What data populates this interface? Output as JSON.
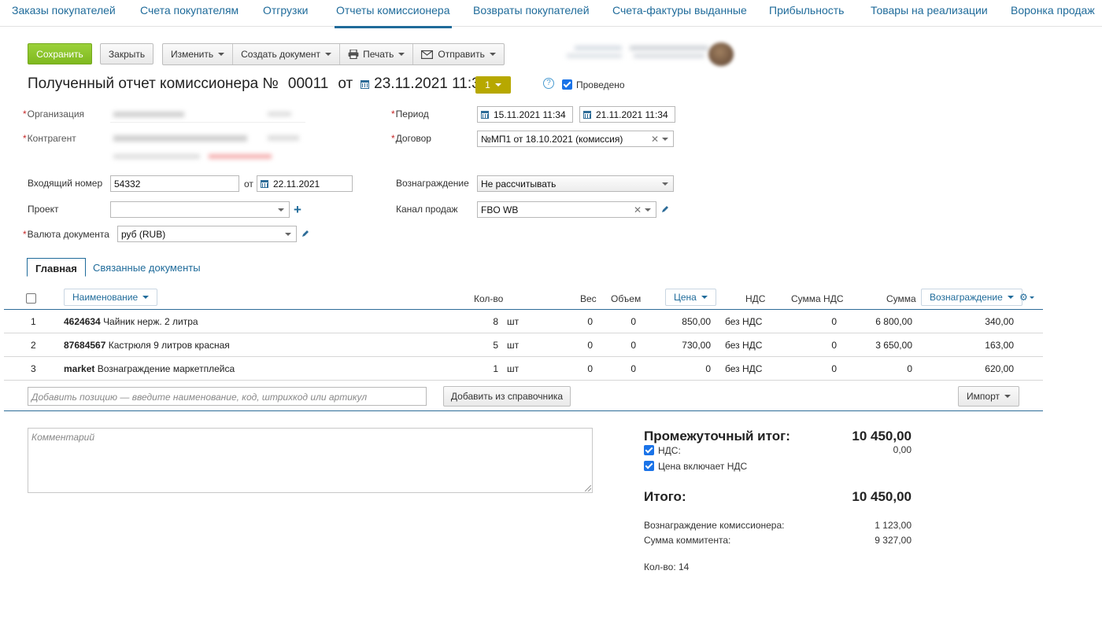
{
  "topnav": [
    {
      "label": "Заказы покупателей"
    },
    {
      "label": "Счета покупателям"
    },
    {
      "label": "Отгрузки"
    },
    {
      "label": "Отчеты комиссионера"
    },
    {
      "label": "Возвраты покупателей"
    },
    {
      "label": "Счета-фактуры выданные"
    },
    {
      "label": "Прибыльность"
    },
    {
      "label": "Товары на реализации"
    },
    {
      "label": "Воронка продаж"
    }
  ],
  "toolbar": {
    "save": "Сохранить",
    "close": "Закрыть",
    "edit": "Изменить",
    "create_doc": "Создать документ",
    "print": "Печать",
    "send": "Отправить"
  },
  "header": {
    "title": "Полученный отчет комиссионера №",
    "number": "00011",
    "ot": "от",
    "datetime": "23.11.2021 11:30",
    "status": "1",
    "posted_label": "Проведено"
  },
  "form": {
    "org_label": "Организация",
    "contractor_label": "Контрагент",
    "period_label": "Период",
    "period_from": "15.11.2021 11:34",
    "period_to": "21.11.2021 11:34",
    "contract_label": "Договор",
    "contract_value": "№МП1 от 18.10.2021 (комиссия)",
    "incoming_label": "Входящий номер",
    "incoming_value": "54332",
    "incoming_ot": "от",
    "incoming_date": "22.11.2021",
    "reward_label": "Вознаграждение",
    "reward_value": "Не рассчитывать",
    "project_label": "Проект",
    "project_value": "",
    "channel_label": "Канал продаж",
    "channel_value": "FBO WB",
    "currency_label": "Валюта документа",
    "currency_value": "руб (RUB)"
  },
  "tabs": {
    "main": "Главная",
    "related": "Связанные документы"
  },
  "table": {
    "headers": {
      "name": "Наименование",
      "qty": "Кол-во",
      "weight": "Вес",
      "volume": "Объем",
      "price": "Цена",
      "vat": "НДС",
      "vat_sum": "Сумма НДС",
      "sum": "Сумма",
      "reward": "Вознаграждение"
    },
    "rows": [
      {
        "n": "1",
        "code": "4624634",
        "name": "Чайник нерж. 2 литра",
        "qty": "8",
        "unit": "шт",
        "weight": "0",
        "volume": "0",
        "price": "850,00",
        "vat": "без НДС",
        "vat_sum": "0",
        "sum": "6 800,00",
        "reward": "340,00"
      },
      {
        "n": "2",
        "code": "87684567",
        "name": "Кастрюля 9 литров красная",
        "qty": "5",
        "unit": "шт",
        "weight": "0",
        "volume": "0",
        "price": "730,00",
        "vat": "без НДС",
        "vat_sum": "0",
        "sum": "3 650,00",
        "reward": "163,00"
      },
      {
        "n": "3",
        "code": "market",
        "name": "Вознаграждение маркетплейса",
        "qty": "1",
        "unit": "шт",
        "weight": "0",
        "volume": "0",
        "price": "0",
        "vat": "без НДС",
        "vat_sum": "0",
        "sum": "0",
        "reward": "620,00"
      }
    ],
    "add_placeholder": "Добавить позицию — введите наименование, код, штрихкод или артикул",
    "add_from_catalog": "Добавить из справочника",
    "import": "Импорт"
  },
  "comment_placeholder": "Комментарий",
  "totals": {
    "subtotal_label": "Промежуточный итог:",
    "subtotal_value": "10 450,00",
    "vat_label": "НДС:",
    "vat_value": "0,00",
    "price_includes_vat": "Цена включает НДС",
    "total_label": "Итого:",
    "total_value": "10 450,00",
    "commission_reward_label": "Вознаграждение комиссионера:",
    "commission_reward_value": "1 123,00",
    "committent_sum_label": "Сумма коммитента:",
    "committent_sum_value": "9 327,00",
    "qty_label": "Кол-во: 14"
  }
}
